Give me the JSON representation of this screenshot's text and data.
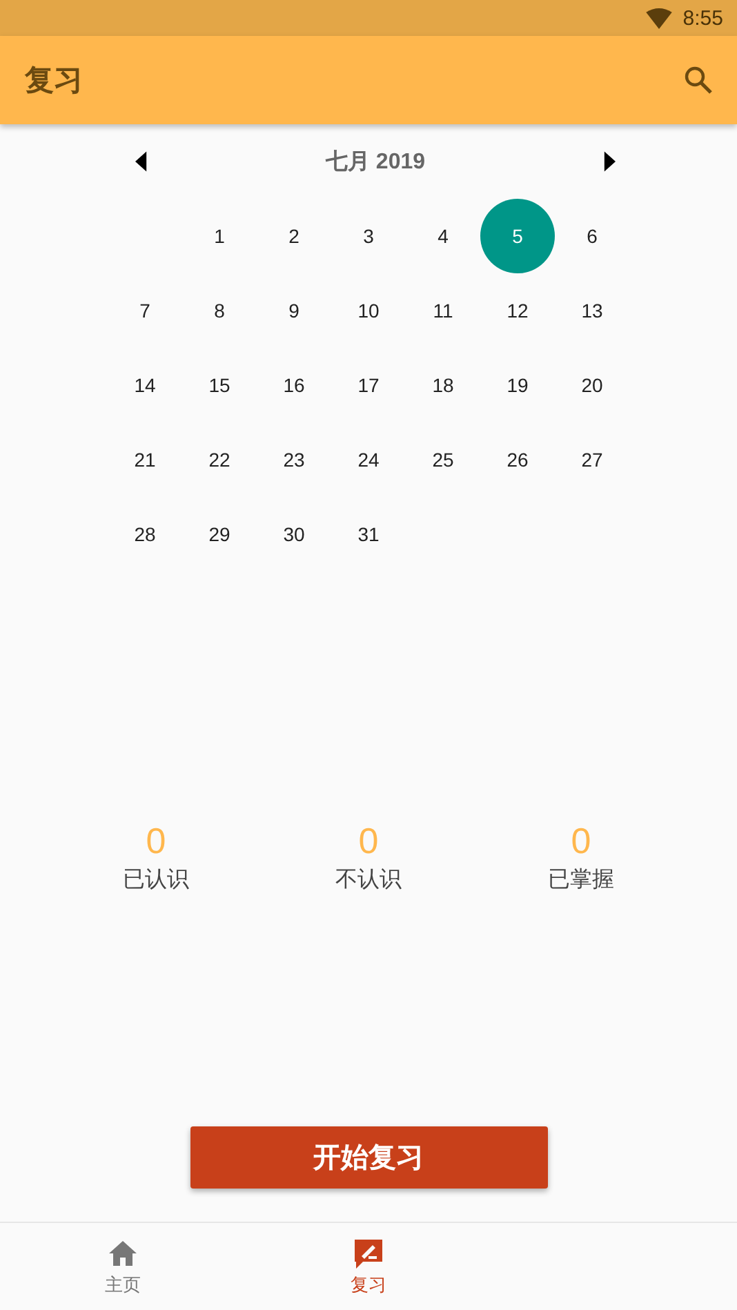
{
  "status_bar": {
    "time": "8:55"
  },
  "app_bar": {
    "title": "复习"
  },
  "calendar": {
    "month": "七月 2019",
    "weeks": [
      [
        {
          "label": "1",
          "selected": false
        },
        {
          "label": "2",
          "selected": false
        },
        {
          "label": "3",
          "selected": false
        },
        {
          "label": "4",
          "selected": false
        },
        {
          "label": "5",
          "selected": true
        },
        {
          "label": "6",
          "selected": false
        }
      ],
      [
        {
          "label": "7",
          "selected": false
        },
        {
          "label": "8",
          "selected": false
        },
        {
          "label": "9",
          "selected": false
        },
        {
          "label": "10",
          "selected": false
        },
        {
          "label": "11",
          "selected": false
        },
        {
          "label": "12",
          "selected": false
        },
        {
          "label": "13",
          "selected": false
        }
      ],
      [
        {
          "label": "14",
          "selected": false
        },
        {
          "label": "15",
          "selected": false
        },
        {
          "label": "16",
          "selected": false
        },
        {
          "label": "17",
          "selected": false
        },
        {
          "label": "18",
          "selected": false
        },
        {
          "label": "19",
          "selected": false
        },
        {
          "label": "20",
          "selected": false
        }
      ],
      [
        {
          "label": "21",
          "selected": false
        },
        {
          "label": "22",
          "selected": false
        },
        {
          "label": "23",
          "selected": false
        },
        {
          "label": "24",
          "selected": false
        },
        {
          "label": "25",
          "selected": false
        },
        {
          "label": "26",
          "selected": false
        },
        {
          "label": "27",
          "selected": false
        }
      ],
      [
        {
          "label": "28",
          "selected": false
        },
        {
          "label": "29",
          "selected": false
        },
        {
          "label": "30",
          "selected": false
        },
        {
          "label": "31",
          "selected": false
        }
      ]
    ]
  },
  "stats": [
    {
      "value": "0",
      "label": "已认识"
    },
    {
      "value": "0",
      "label": "不认识"
    },
    {
      "value": "0",
      "label": "已掌握"
    }
  ],
  "start_button": "开始复习",
  "bottom_nav": [
    {
      "kind": "home",
      "label": "主页",
      "selected": false
    },
    {
      "kind": "review",
      "label": "复习",
      "selected": true
    }
  ]
}
